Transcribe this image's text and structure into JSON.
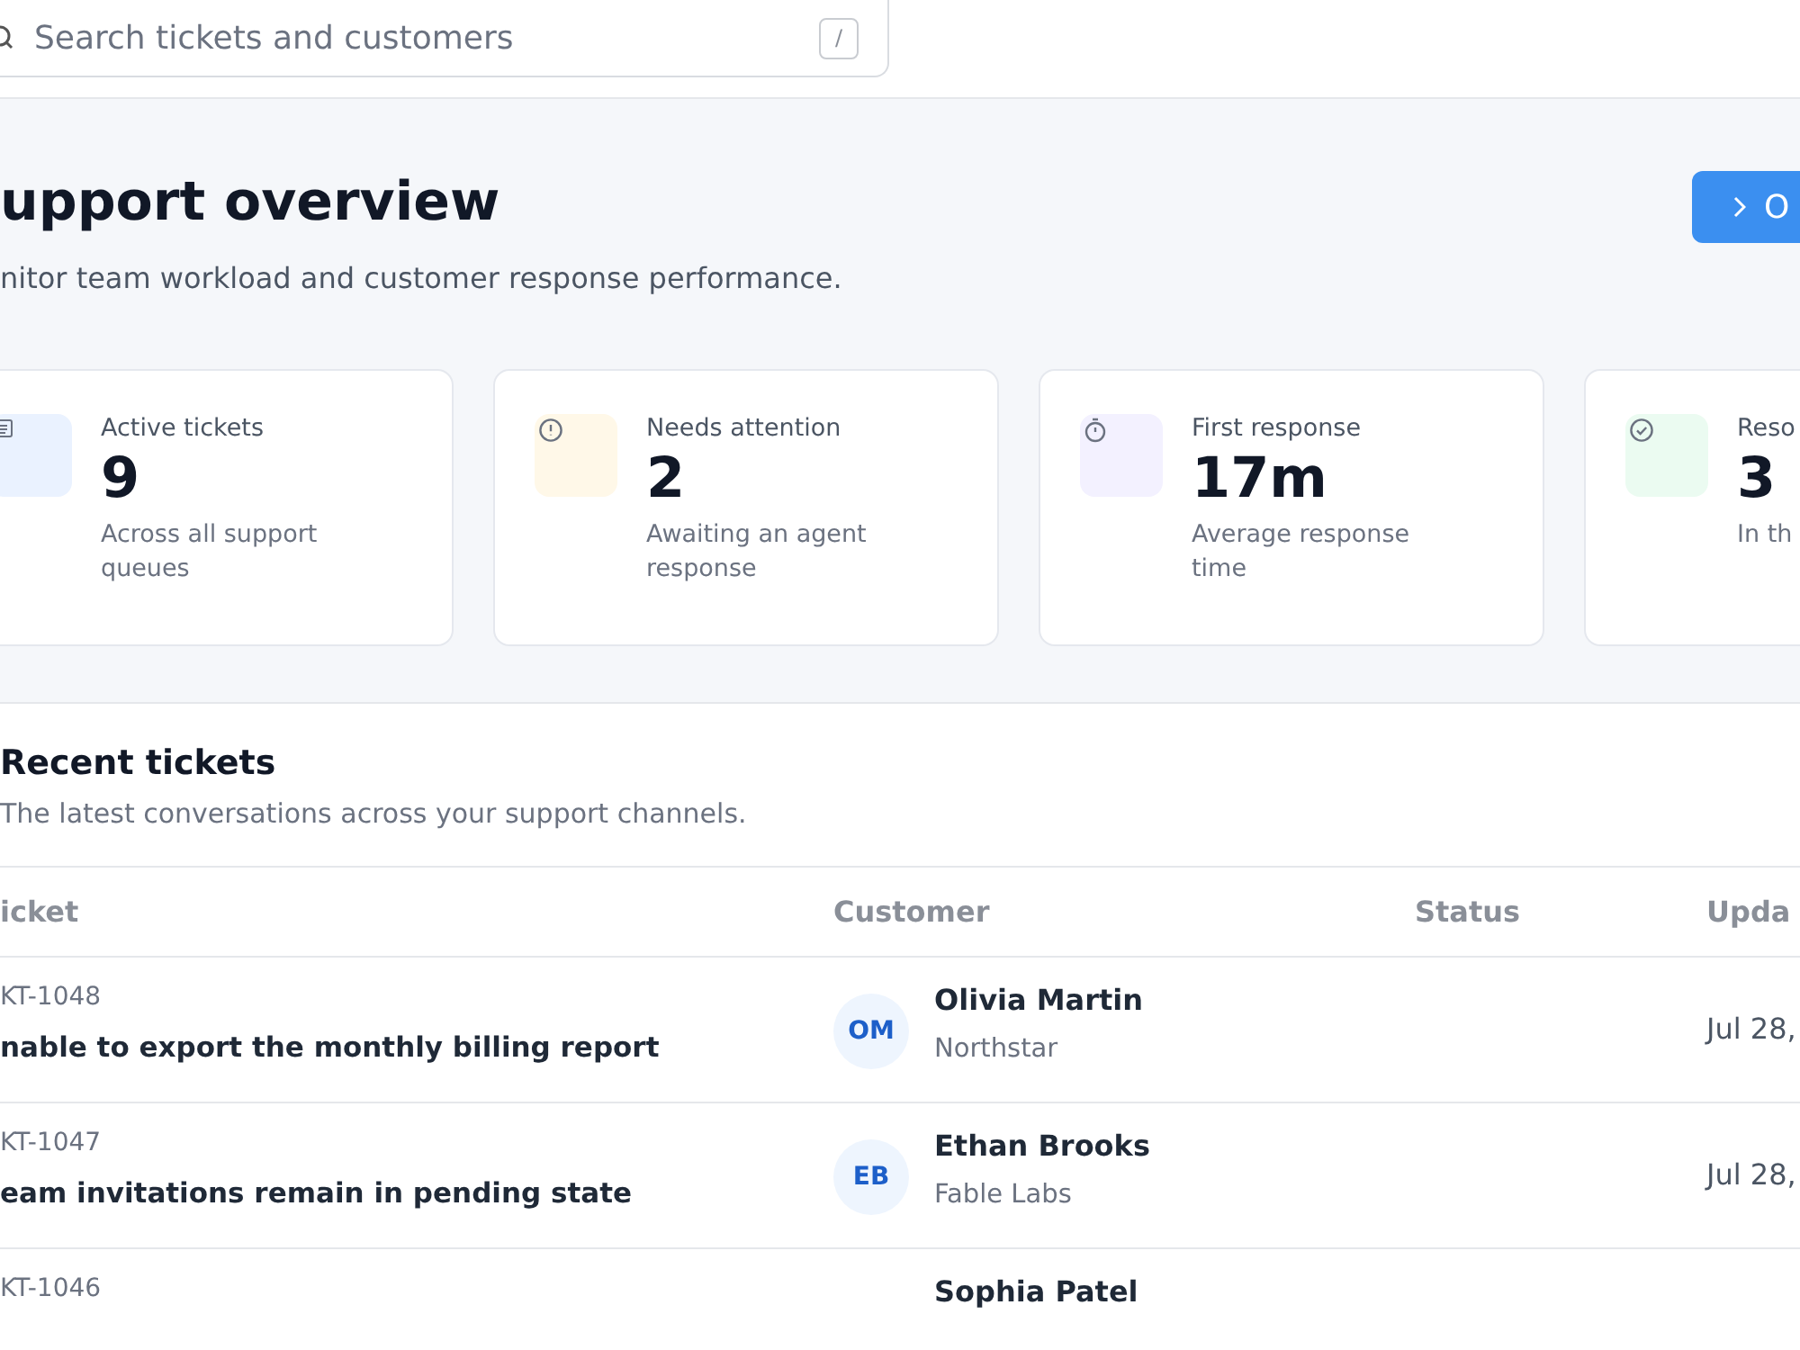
{
  "search": {
    "placeholder": "Search tickets and customers",
    "shortcut": "/"
  },
  "overview": {
    "title": "upport overview",
    "subtitle": "nitor team workload and customer response performance.",
    "action": {
      "label": "O"
    }
  },
  "stats": [
    {
      "kind": "document",
      "color": "#eaf2ff",
      "label": "Active tickets",
      "value": "9",
      "note": "Across all support queues"
    },
    {
      "kind": "alert",
      "color": "#fff8e8",
      "label": "Needs attention",
      "value": "2",
      "note": "Awaiting an agent response"
    },
    {
      "kind": "timer",
      "color": "#f3f1ff",
      "label": "First response",
      "value": "17m",
      "note": "Average response time"
    },
    {
      "kind": "check",
      "color": "#ebfbf1",
      "label": "Reso",
      "value": "3",
      "note": "In th"
    }
  ],
  "tickets": {
    "title": "Recent tickets",
    "subtitle": "The latest conversations across your support channels.",
    "columns": [
      "icket",
      "Customer",
      "Status",
      "Upda"
    ],
    "rows": [
      {
        "id": "KT-1048",
        "subject": "nable to export the monthly billing report",
        "initials": "OM",
        "customer": "Olivia Martin",
        "company": "Northstar",
        "updated": "Jul 28,"
      },
      {
        "id": "KT-1047",
        "subject": "eam invitations remain in pending state",
        "initials": "EB",
        "customer": "Ethan Brooks",
        "company": "Fable Labs",
        "updated": "Jul 28,"
      },
      {
        "id": "KT-1046",
        "customer": "Sophia Patel"
      }
    ]
  }
}
